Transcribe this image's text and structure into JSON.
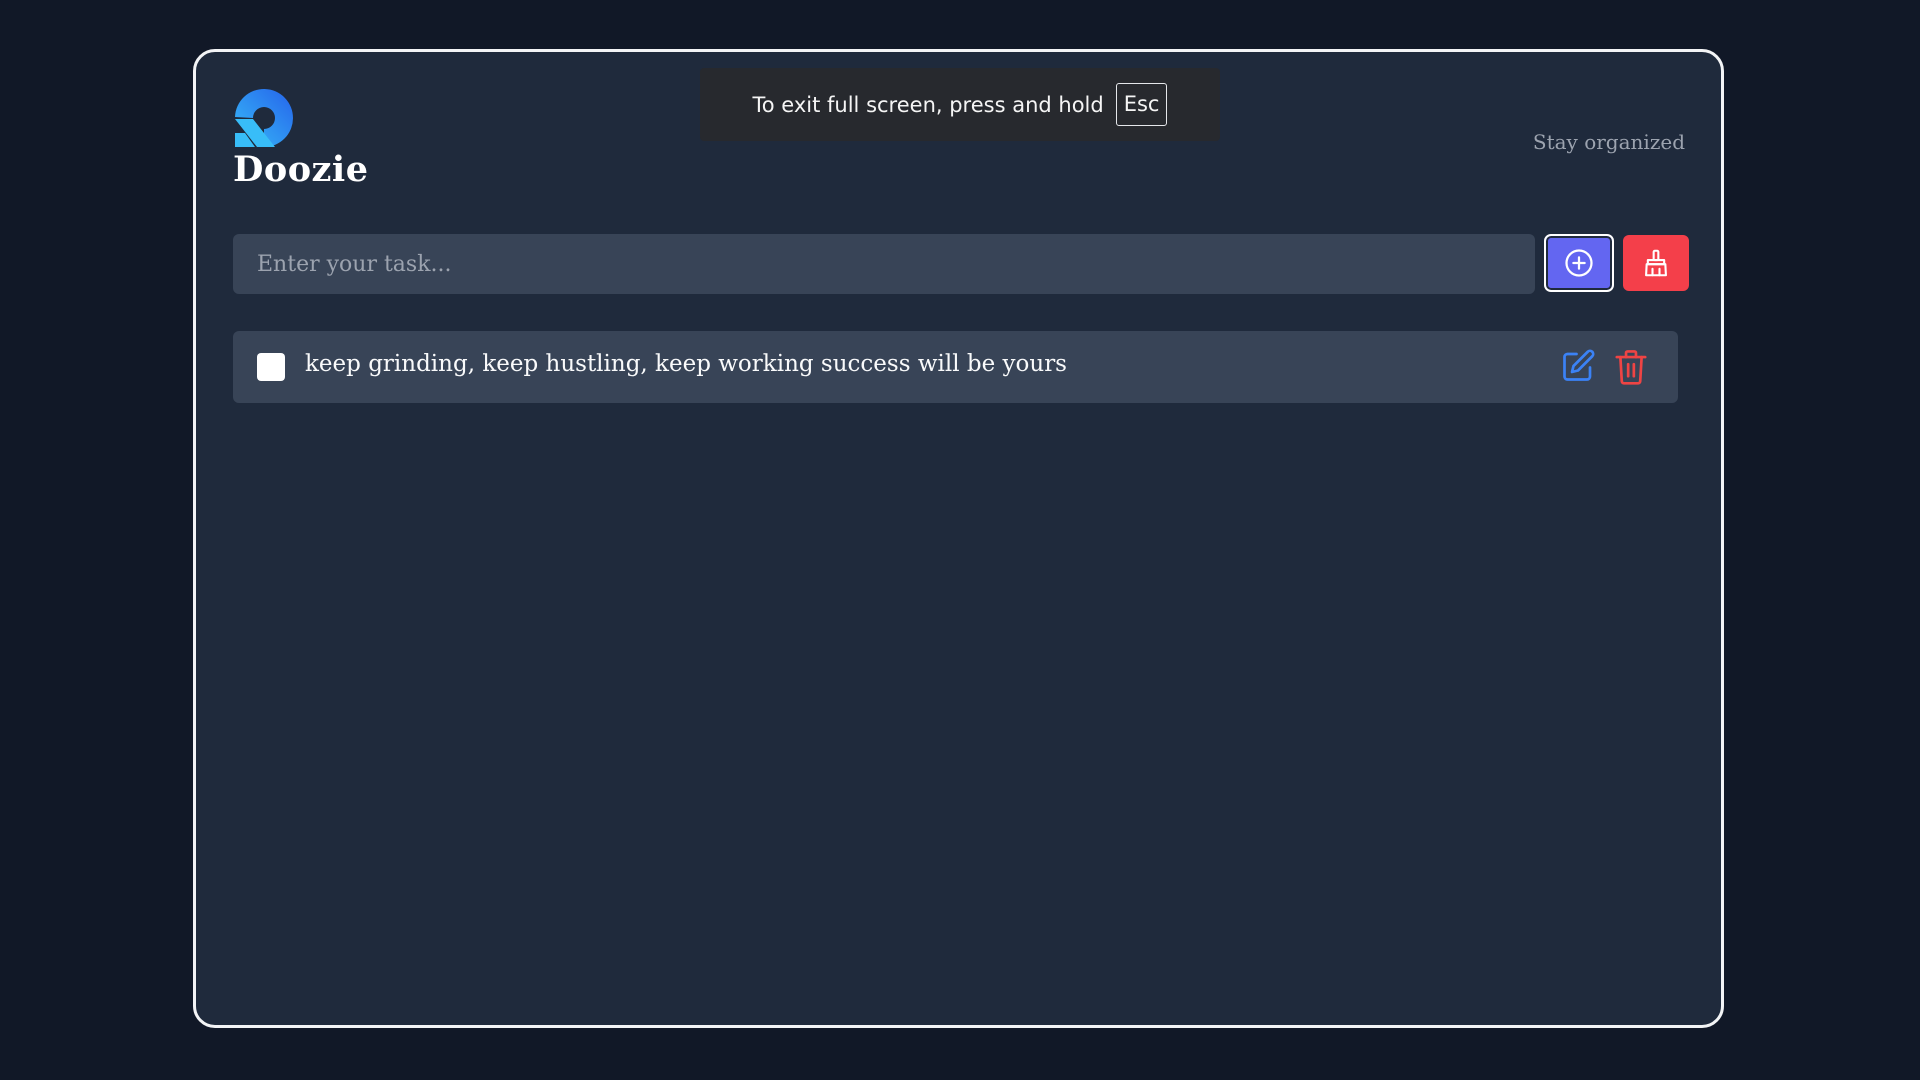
{
  "app": {
    "name": "Doozie",
    "tagline": "Stay organized"
  },
  "fullscreen_notice": {
    "message": "To exit full screen, press and hold",
    "key": "Esc"
  },
  "task_input": {
    "placeholder": "Enter your task...",
    "value": ""
  },
  "toolbar": {
    "add_icon": "plus-circle-icon",
    "clear_icon": "broom-icon"
  },
  "tasks": [
    {
      "text": "keep grinding, keep hustling, keep working success will be yours",
      "completed": false,
      "edit_icon": "pencil-square-icon",
      "delete_icon": "trash-icon"
    }
  ],
  "colors": {
    "background": "#111827",
    "panel": "#1f2a3c",
    "input": "#384457",
    "add_button": "#6366f1",
    "clear_button": "#f43f4a",
    "edit_icon": "#3b82f6",
    "delete_icon": "#ef4444",
    "logo": "#2f7cf6"
  }
}
